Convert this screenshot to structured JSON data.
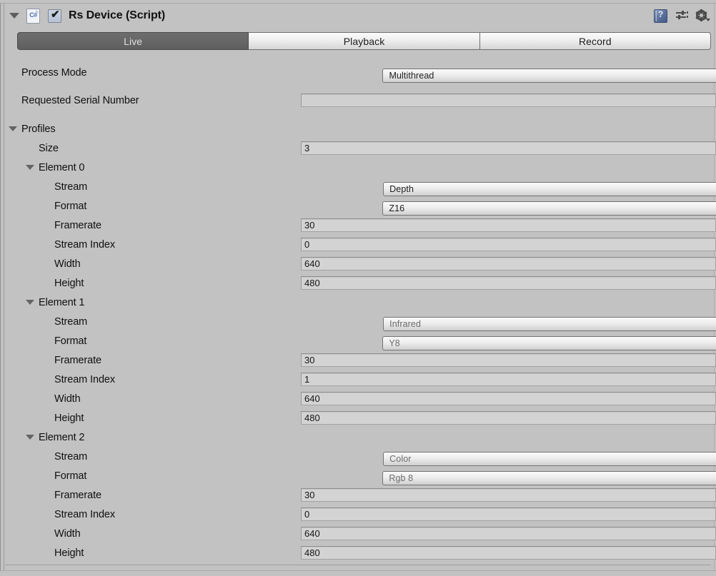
{
  "component": {
    "title": "Rs Device (Script)",
    "script_icon_label": "C#",
    "enabled": true,
    "checkmark": "✔",
    "help_glyph": "?"
  },
  "header_icons": [
    {
      "name": "help-icon",
      "label": "Help"
    },
    {
      "name": "preset-icon",
      "label": "Presets"
    },
    {
      "name": "settings-gear-icon",
      "label": "Settings"
    }
  ],
  "tabs": [
    {
      "label": "Live",
      "active": true
    },
    {
      "label": "Playback",
      "active": false
    },
    {
      "label": "Record",
      "active": false
    }
  ],
  "fields": {
    "process_mode": {
      "label": "Process Mode",
      "value": "Multithread",
      "type": "popup"
    },
    "requested_serial_number": {
      "label": "Requested Serial Number",
      "value": "",
      "type": "text"
    }
  },
  "profiles": {
    "label": "Profiles",
    "size_label": "Size",
    "size_value": "3",
    "field_labels": {
      "stream": "Stream",
      "format": "Format",
      "framerate": "Framerate",
      "stream_index": "Stream Index",
      "width": "Width",
      "height": "Height"
    },
    "elements": [
      {
        "label": "Element 0",
        "stream": "Depth",
        "format": "Z16",
        "format_dim": false,
        "framerate": "30",
        "stream_index": "0",
        "width": "640",
        "height": "480"
      },
      {
        "label": "Element 1",
        "stream": "Infrared",
        "format": "Y8",
        "format_dim": true,
        "framerate": "30",
        "stream_index": "1",
        "width": "640",
        "height": "480"
      },
      {
        "label": "Element 2",
        "stream": "Color",
        "format": "Rgb 8",
        "format_dim": true,
        "framerate": "30",
        "stream_index": "0",
        "width": "640",
        "height": "480"
      }
    ]
  },
  "colors": {
    "background": "#c2c2c2",
    "active_tab": "#676767",
    "active_tab_text": "#dfdfdf",
    "text": "#101010",
    "field_fill": "#d3d3d3"
  }
}
